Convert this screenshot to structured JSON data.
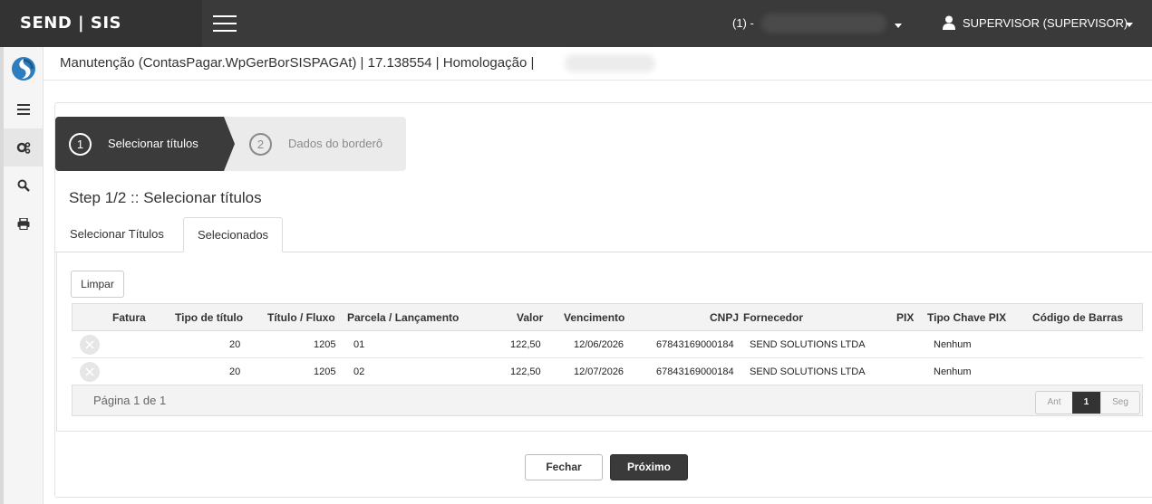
{
  "app": {
    "brand": "SEND | SIS"
  },
  "header": {
    "company_label": "(1) -",
    "user_label": "SUPERVISOR (SUPERVISOR)"
  },
  "sidebar": {
    "items": [
      {
        "icon": "app-logo-icon"
      },
      {
        "icon": "list-icon"
      },
      {
        "icon": "gears-icon"
      },
      {
        "icon": "search-icon"
      },
      {
        "icon": "print-icon"
      }
    ]
  },
  "breadcrumb": "Manutenção (ContasPagar.WpGerBorSISPAGAt) | 17.138554 | Homologação |",
  "wizard": {
    "steps": [
      {
        "number": "1",
        "label": "Selecionar títulos",
        "active": true
      },
      {
        "number": "2",
        "label": "Dados do borderô",
        "active": false
      }
    ],
    "title": "Step 1/2 :: Selecionar títulos"
  },
  "tabs": [
    {
      "label": "Selecionar Títulos",
      "active": false
    },
    {
      "label": "Selecionados",
      "active": true
    }
  ],
  "limpar_label": "Limpar",
  "table": {
    "columns": [
      "Fatura",
      "Tipo de título",
      "Título / Fluxo",
      "Parcela / Lançamento",
      "Valor",
      "Vencimento",
      "CNPJ",
      "Fornecedor",
      "PIX",
      "Tipo Chave PIX",
      "Código de Barras"
    ],
    "rows": [
      {
        "fatura": "",
        "tipo": "20",
        "titulo": "1205",
        "parcela": "01",
        "valor": "122,50",
        "vencimento": "12/06/2026",
        "cnpj": "67843169000184",
        "fornecedor": "SEND SOLUTIONS LTDA",
        "pix": "",
        "tipo_chave": "Nenhum",
        "codigo": ""
      },
      {
        "fatura": "",
        "tipo": "20",
        "titulo": "1205",
        "parcela": "02",
        "valor": "122,50",
        "vencimento": "12/07/2026",
        "cnpj": "67843169000184",
        "fornecedor": "SEND SOLUTIONS LTDA",
        "pix": "",
        "tipo_chave": "Nenhum",
        "codigo": ""
      }
    ],
    "page_info": "Página 1 de 1",
    "pager": {
      "prev": "Ant",
      "current": "1",
      "next": "Seg"
    }
  },
  "footer": {
    "close_label": "Fechar",
    "next_label": "Próximo"
  },
  "colors": {
    "topbar": "#3a3a3a",
    "primary_button": "#3a3a3a",
    "accent_logo": "#2e7dbf"
  }
}
